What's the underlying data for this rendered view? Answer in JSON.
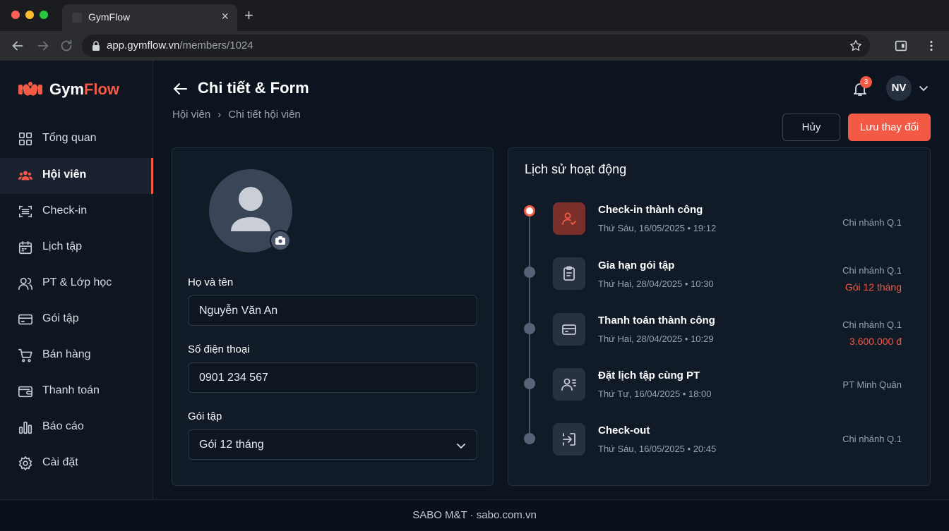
{
  "browser": {
    "tab_title": "GymFlow",
    "url_host": "app.gymflow.vn",
    "url_path": "/members/1024"
  },
  "brand": {
    "name_part1": "Gym",
    "name_part2": "Flow",
    "accent_color": "#f35a46"
  },
  "sidebar": {
    "items": [
      {
        "label": "Tổng quan",
        "icon": "grid-icon"
      },
      {
        "label": "Hội viên",
        "icon": "users-icon",
        "active": true
      },
      {
        "label": "Check-in",
        "icon": "scan-icon"
      },
      {
        "label": "Lịch tập",
        "icon": "calendar-icon"
      },
      {
        "label": "PT & Lớp học",
        "icon": "trainer-icon"
      },
      {
        "label": "Gói tập",
        "icon": "card-icon"
      },
      {
        "label": "Bán hàng",
        "icon": "cart-icon"
      },
      {
        "label": "Thanh toán",
        "icon": "wallet-icon"
      },
      {
        "label": "Báo cáo",
        "icon": "chart-icon"
      },
      {
        "label": "Cài đặt",
        "icon": "gear-icon"
      }
    ]
  },
  "header": {
    "title": "Chi tiết & Form",
    "breadcrumb": [
      "Hội viên",
      "Chi tiết hội viên"
    ],
    "notification_count": "3",
    "user_initials": "NV",
    "cancel_label": "Hủy",
    "save_label": "Lưu thay đổi"
  },
  "form": {
    "name_label": "Họ và tên",
    "name_value": "Nguyễn Văn An",
    "phone_label": "Số điện thoại",
    "phone_value": "0901 234 567",
    "package_label": "Gói tập",
    "package_value": "Gói 12 tháng"
  },
  "activity": {
    "title": "Lịch sử hoạt động",
    "items": [
      {
        "name": "Check-in thành công",
        "day": "Thứ Sáu, 16/05/2025",
        "time": "19:12",
        "location": "Chi nhánh Q.1",
        "extra": "",
        "icon": "checkin-icon"
      },
      {
        "name": "Gia hạn gói tập",
        "day": "Thứ Hai, 28/04/2025",
        "time": "10:30",
        "location": "Chi nhánh Q.1",
        "extra": "Gói 12 tháng",
        "icon": "clipboard-icon"
      },
      {
        "name": "Thanh toán thành công",
        "day": "Thứ Hai, 28/04/2025",
        "time": "10:29",
        "location": "Chi nhánh Q.1",
        "extra": "3.600.000 đ",
        "icon": "payment-card-icon"
      },
      {
        "name": "Đặt lịch tập cùng PT",
        "day": "Thứ Tư, 16/04/2025",
        "time": "18:00",
        "location": "PT Minh Quân",
        "extra": "",
        "icon": "trainer-booking-icon"
      },
      {
        "name": "Check-out",
        "day": "Thứ Sáu, 16/05/2025",
        "time": "20:45",
        "location": "Chi nhánh Q.1",
        "extra": "",
        "icon": "checkout-icon"
      }
    ]
  },
  "footer": {
    "text": "SABO M&T · sabo.com.vn"
  }
}
